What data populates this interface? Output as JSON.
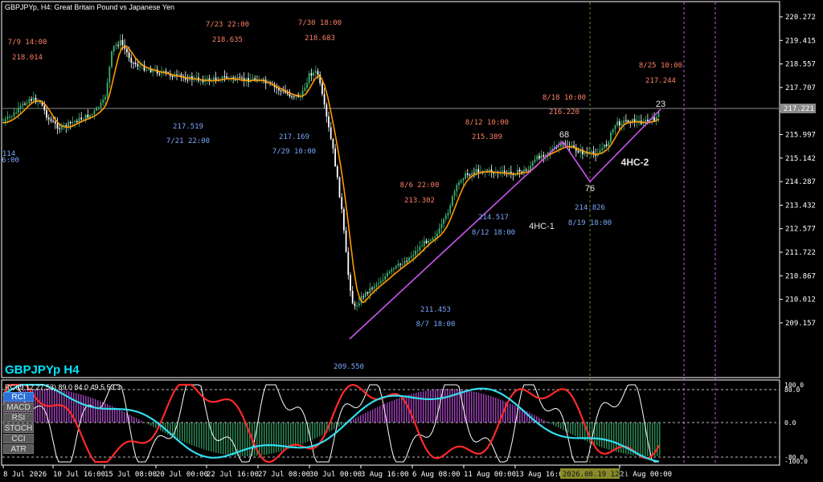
{
  "header": {
    "symbol_info": "GBPJPYp, H4:  Great Britain Pound vs Japanese Yen",
    "big_label": "GBPJPYp H4",
    "current_price": "217.221"
  },
  "price_axis": [
    "220.272",
    "219.415",
    "218.557",
    "217.707",
    "216.852",
    "215.997",
    "215.142",
    "214.287",
    "213.432",
    "212.577",
    "211.722",
    "210.867",
    "210.012",
    "209.157"
  ],
  "indicator_header": "RCI(9,12,27,53) 89.0 84.0 49.5 53.3",
  "indicator_axis": [
    "100.0",
    "80.0",
    "0.0",
    "-80.0",
    "-100.0"
  ],
  "indicator_buttons": [
    {
      "label": "RCI",
      "active": true
    },
    {
      "label": "MACD",
      "active": false
    },
    {
      "label": "RSI",
      "active": false
    },
    {
      "label": "STOCH",
      "active": false
    },
    {
      "label": "CCI",
      "active": false
    },
    {
      "label": "ATR",
      "active": false
    }
  ],
  "time_axis": [
    "8 Jul 2026",
    "10 Jul 16:00",
    "15 Jul 08:00",
    "20 Jul 00:00",
    "22 Jul 16:00",
    "27 Jul 08:00",
    "30 Jul 00:00",
    "3 Aug 16:00",
    "6 Aug 08:00",
    "11 Aug 00:00",
    "13 Aug 16:00",
    "21 Aug 00:00"
  ],
  "time_cursor": "2026.08.19 12:00",
  "price_annotations": [
    {
      "kind": "high",
      "date": "7/9 14:00",
      "price": "218.014"
    },
    {
      "kind": "high",
      "date": "7/23 22:00",
      "price": "218.635"
    },
    {
      "kind": "high",
      "date": "7/30 18:00",
      "price": "218.683"
    },
    {
      "kind": "low",
      "date": "7/21 22:00",
      "price": "217.519"
    },
    {
      "kind": "low",
      "date": "7/29 10:00",
      "price": "217.169"
    },
    {
      "kind": "high",
      "date": "8/6 22:00",
      "price": "213.302"
    },
    {
      "kind": "high",
      "date": "8/12 10:00",
      "price": "215.389"
    },
    {
      "kind": "high",
      "date": "8/18 10:00",
      "price": "216.220"
    },
    {
      "kind": "high",
      "date": "8/25 10:00",
      "price": "217.244"
    },
    {
      "kind": "low",
      "date": "8/7 18:00",
      "price": "211.453"
    },
    {
      "kind": "low",
      "date": "8/12 18:00",
      "price": "214.517"
    },
    {
      "kind": "low",
      "date": "8/19 18:00",
      "price": "214.826"
    },
    {
      "kind": "low",
      "date": "",
      "price": "209.550"
    },
    {
      "kind": "low",
      "date": "6:00",
      "price": "114"
    }
  ],
  "wave_labels": [
    "68",
    "76",
    "23",
    "4HC-1",
    "4HC-2"
  ],
  "colors": {
    "background": "#000000",
    "bull": "#3cb371",
    "bear": "#ffffff",
    "ma": "#ff9900",
    "trendline": "#cc55ee",
    "high_text": "#ff7f66",
    "low_text": "#7aa7ff",
    "big_label": "#00e5ff",
    "grid_frame": "#ffffff",
    "rci_red": "#ff2a2a",
    "rci_cyan": "#33ddee",
    "rci_white": "#ffffff",
    "histo_pos": "#cc55ee",
    "histo_neg": "#3cb371"
  }
}
